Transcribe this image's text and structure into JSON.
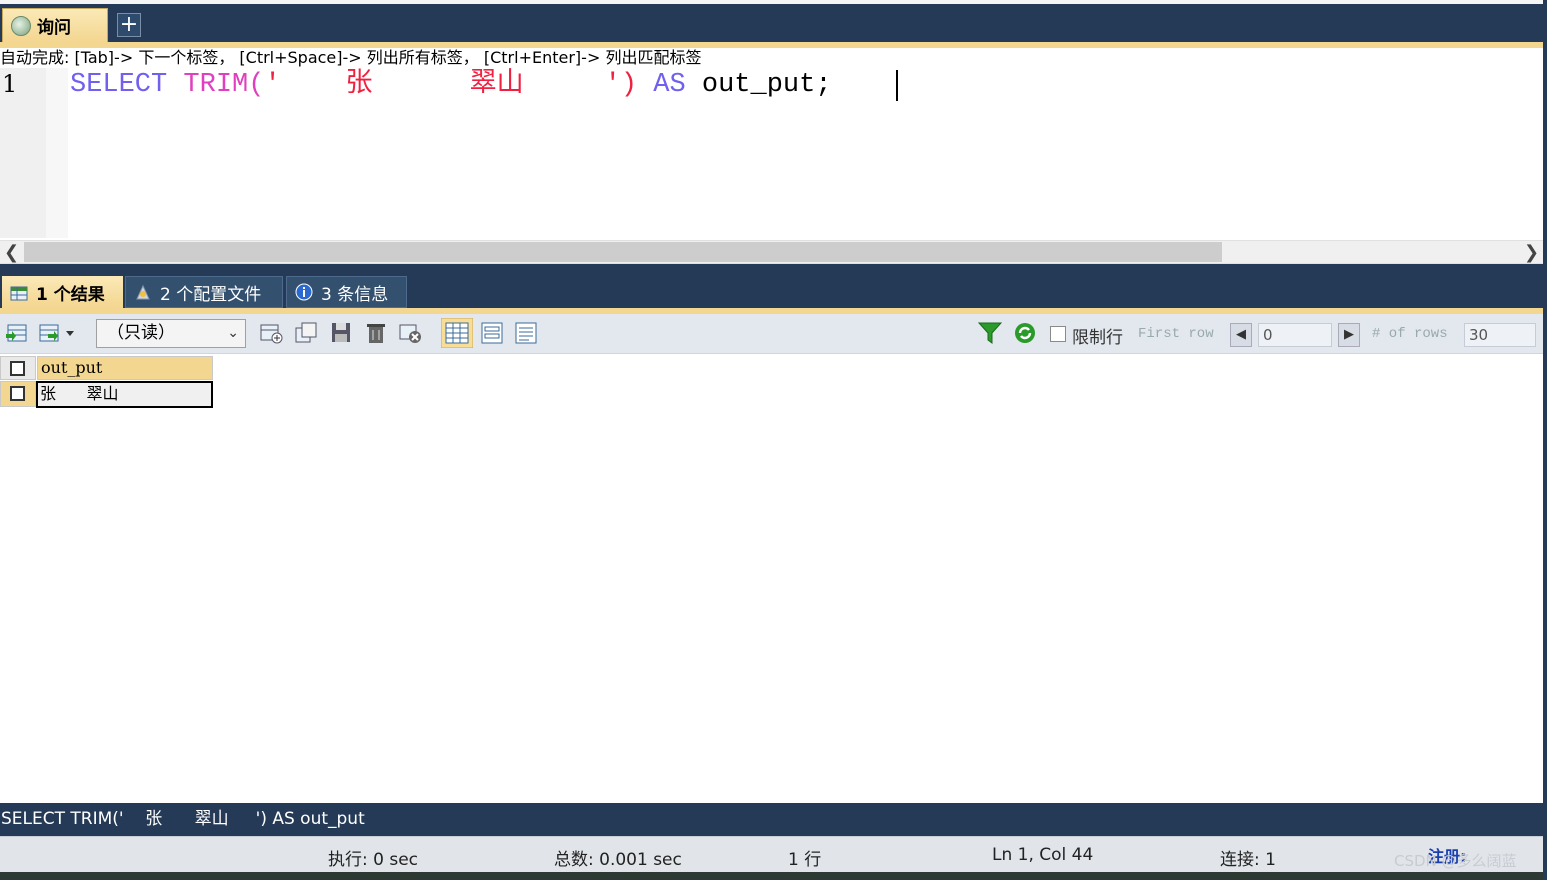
{
  "window": {
    "query_tab_label": "询问",
    "add_tab_symbol": "+"
  },
  "editor": {
    "autocomplete_hint": "自动完成:  [Tab]-> 下一个标签，  [Ctrl+Space]-> 列出所有标签，  [Ctrl+Enter]-> 列出匹配标签",
    "line_number": "1",
    "code": {
      "kw_select": "SELECT",
      "fn_trim": "TRIM",
      "paren_open": "(",
      "string_literal": "'    张      翠山     '",
      "paren_close": ")",
      "kw_as": "AS",
      "alias": "out_put;"
    }
  },
  "results": {
    "tabs": [
      {
        "label": "1 个结果"
      },
      {
        "label": "2 个配置文件"
      },
      {
        "label": "3 条信息"
      }
    ],
    "toolbar": {
      "readonly_select": "（只读）",
      "limit_rows_label": "限制行",
      "first_row_label": "First row",
      "first_row_value": "0",
      "rows_label": "# of rows",
      "rows_value": "30"
    },
    "grid": {
      "columns": [
        "out_put"
      ],
      "rows": [
        [
          "张      翠山"
        ]
      ]
    }
  },
  "footer": {
    "sql_text": "SELECT TRIM('    张      翠山     ') AS out_put",
    "exec_time": "执行: 0 sec",
    "total_time": "总数: 0.001 sec",
    "row_count": "1 行",
    "cursor_pos": "Ln 1, Col 44",
    "connections": "连接: 1",
    "registration": "注册: ",
    "watermark": "CSDN @多么阔蓝"
  },
  "colors": {
    "chrome_dark": "#243a56",
    "tab_gold": "#f3d690",
    "keyword": "#7060f0",
    "function": "#e040c0",
    "string": "#f02040"
  }
}
